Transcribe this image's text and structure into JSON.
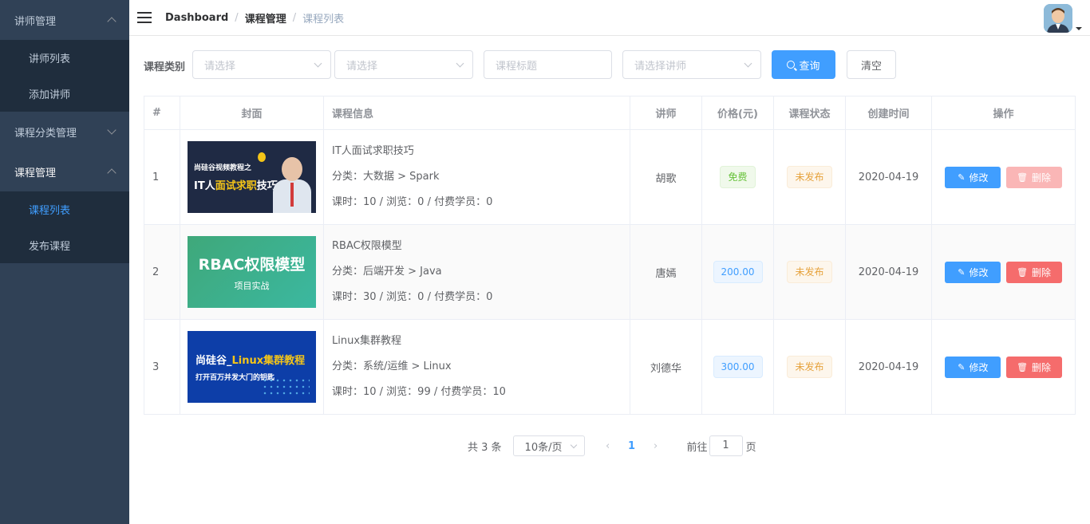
{
  "sidebar": {
    "groups": [
      {
        "label": "讲师管理",
        "expanded": true,
        "items": [
          {
            "label": "讲师列表"
          },
          {
            "label": "添加讲师"
          }
        ]
      },
      {
        "label": "课程分类管理",
        "expanded": false,
        "items": []
      },
      {
        "label": "课程管理",
        "expanded": true,
        "items": [
          {
            "label": "课程列表",
            "active": true
          },
          {
            "label": "发布课程"
          }
        ]
      }
    ]
  },
  "header": {
    "breadcrumb": [
      "Dashboard",
      "课程管理",
      "课程列表"
    ],
    "breadcrumb_sep": "/"
  },
  "filter": {
    "label": "课程类别",
    "subject_level1_placeholder": "请选择",
    "subject_level2_placeholder": "请选择",
    "title_placeholder": "课程标题",
    "teacher_placeholder": "请选择讲师",
    "search_label": "查询",
    "clear_label": "清空"
  },
  "table": {
    "columns": [
      "#",
      "封面",
      "课程信息",
      "讲师",
      "价格(元)",
      "课程状态",
      "创建时间",
      "操作"
    ],
    "rows": [
      {
        "index": "1",
        "cover": {
          "line1": "尚硅谷视频教程之",
          "line2a": "IT人",
          "line2b": "面试求职",
          "line2c": "技巧"
        },
        "title": "IT人面试求职技巧",
        "category": "分类：大数据 > Spark",
        "stats": "课时：10 / 浏览：0 / 付费学员：0",
        "teacher": "胡歌",
        "price": "免费",
        "price_type": "free",
        "status": "未发布",
        "created": "2020-04-19",
        "edit_label": "修改",
        "delete_label": "删除",
        "delete_disabled": true
      },
      {
        "index": "2",
        "cover": {
          "line1": "项目实战",
          "line2a": "RBAC权限模型",
          "line2b": "",
          "line2c": ""
        },
        "title": "RBAC权限模型",
        "category": "分类：后端开发 > Java",
        "stats": "课时：30 / 浏览：0 / 付费学员：0",
        "teacher": "唐嫣",
        "price": "200.00",
        "price_type": "paid",
        "status": "未发布",
        "created": "2020-04-19",
        "edit_label": "修改",
        "delete_label": "删除",
        "delete_disabled": false
      },
      {
        "index": "3",
        "cover": {
          "line1": "打开百万并发大门的钥匙",
          "line2a": "尚硅谷_",
          "line2b": "Linux集群教程",
          "line2c": ""
        },
        "title": "Linux集群教程",
        "category": "分类：系统/运维 > Linux",
        "stats": "课时：10 / 浏览：99 / 付费学员：10",
        "teacher": "刘德华",
        "price": "300.00",
        "price_type": "paid",
        "status": "未发布",
        "created": "2020-04-19",
        "edit_label": "修改",
        "delete_label": "删除",
        "delete_disabled": false
      }
    ]
  },
  "pagination": {
    "total": "共 3 条",
    "page_size": "10条/页",
    "current_page": "1",
    "goto_prefix": "前往",
    "goto_value": "1",
    "goto_suffix": "页"
  },
  "colors": {
    "sidebar_bg": "#304156",
    "submenu_bg": "#1f2d3d",
    "primary": "#409eff",
    "danger": "#f56c6c",
    "success": "#67c23a",
    "warning": "#e6a23c"
  }
}
